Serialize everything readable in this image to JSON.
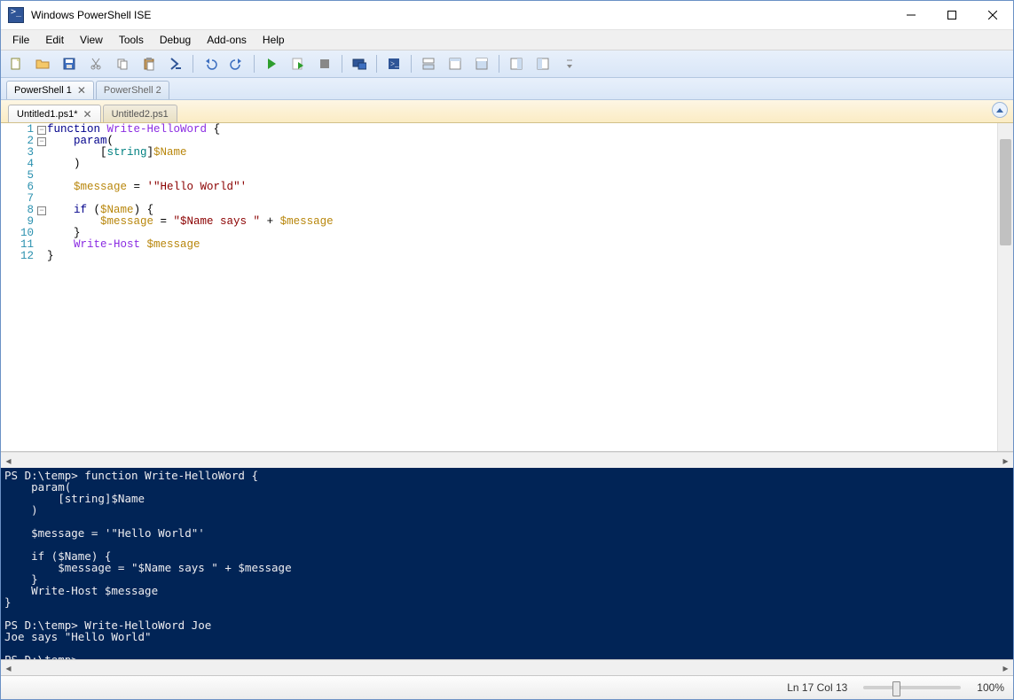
{
  "titlebar": {
    "title": "Windows PowerShell ISE"
  },
  "menu": [
    "File",
    "Edit",
    "View",
    "Tools",
    "Debug",
    "Add-ons",
    "Help"
  ],
  "toolbar": {
    "icons": [
      "new-file",
      "open-file",
      "save",
      "cut",
      "copy",
      "paste",
      "run-ps",
      "sep",
      "undo",
      "redo",
      "sep",
      "run",
      "run-selection",
      "stop",
      "sep",
      "remote",
      "sep",
      "open-console",
      "sep",
      "layout-both",
      "layout-script",
      "layout-console",
      "sep",
      "show-cmd",
      "show-cmd-addon",
      "overflow"
    ]
  },
  "ps_tabs": [
    {
      "label": "PowerShell 1",
      "active": true,
      "closeable": true
    },
    {
      "label": "PowerShell 2",
      "active": false,
      "closeable": false
    }
  ],
  "file_tabs": [
    {
      "label": "Untitled1.ps1*",
      "active": true,
      "closeable": true
    },
    {
      "label": "Untitled2.ps1",
      "active": false,
      "closeable": false
    }
  ],
  "editor": {
    "lines": 12,
    "code_tokens": [
      [
        [
          "kw",
          "function"
        ],
        [
          "txt",
          " "
        ],
        [
          "cmd",
          "Write-HelloWord"
        ],
        [
          "txt",
          " {"
        ]
      ],
      [
        [
          "txt",
          "    "
        ],
        [
          "kw",
          "param"
        ],
        [
          "txt",
          "("
        ]
      ],
      [
        [
          "txt",
          "        ["
        ],
        [
          "type",
          "string"
        ],
        [
          "txt",
          "]"
        ],
        [
          "var",
          "$Name"
        ]
      ],
      [
        [
          "txt",
          "    )"
        ]
      ],
      [
        [
          "txt",
          ""
        ]
      ],
      [
        [
          "txt",
          "    "
        ],
        [
          "var",
          "$message"
        ],
        [
          "txt",
          " = "
        ],
        [
          "str",
          "'\"Hello World\"'"
        ]
      ],
      [
        [
          "txt",
          ""
        ]
      ],
      [
        [
          "txt",
          "    "
        ],
        [
          "kw",
          "if"
        ],
        [
          "txt",
          " ("
        ],
        [
          "var",
          "$Name"
        ],
        [
          "txt",
          ") {"
        ]
      ],
      [
        [
          "txt",
          "        "
        ],
        [
          "var",
          "$message"
        ],
        [
          "txt",
          " = "
        ],
        [
          "str",
          "\"$Name says \""
        ],
        [
          "txt",
          " + "
        ],
        [
          "var",
          "$message"
        ]
      ],
      [
        [
          "txt",
          "    }"
        ]
      ],
      [
        [
          "txt",
          "    "
        ],
        [
          "cmd",
          "Write-Host"
        ],
        [
          "txt",
          " "
        ],
        [
          "var",
          "$message"
        ]
      ],
      [
        [
          "txt",
          "}"
        ]
      ]
    ],
    "folds": {
      "1": "minus",
      "2": "minus",
      "8": "minus"
    }
  },
  "console": {
    "text": "PS D:\\temp> function Write-HelloWord {\n    param(\n        [string]$Name\n    )\n\n    $message = '\"Hello World\"'\n\n    if ($Name) {\n        $message = \"$Name says \" + $message\n    }\n    Write-Host $message\n}\n\nPS D:\\temp> Write-HelloWord Joe\nJoe says \"Hello World\"\n\nPS D:\\temp> "
  },
  "status": {
    "position": "Ln 17  Col 13",
    "zoom": "100%"
  }
}
